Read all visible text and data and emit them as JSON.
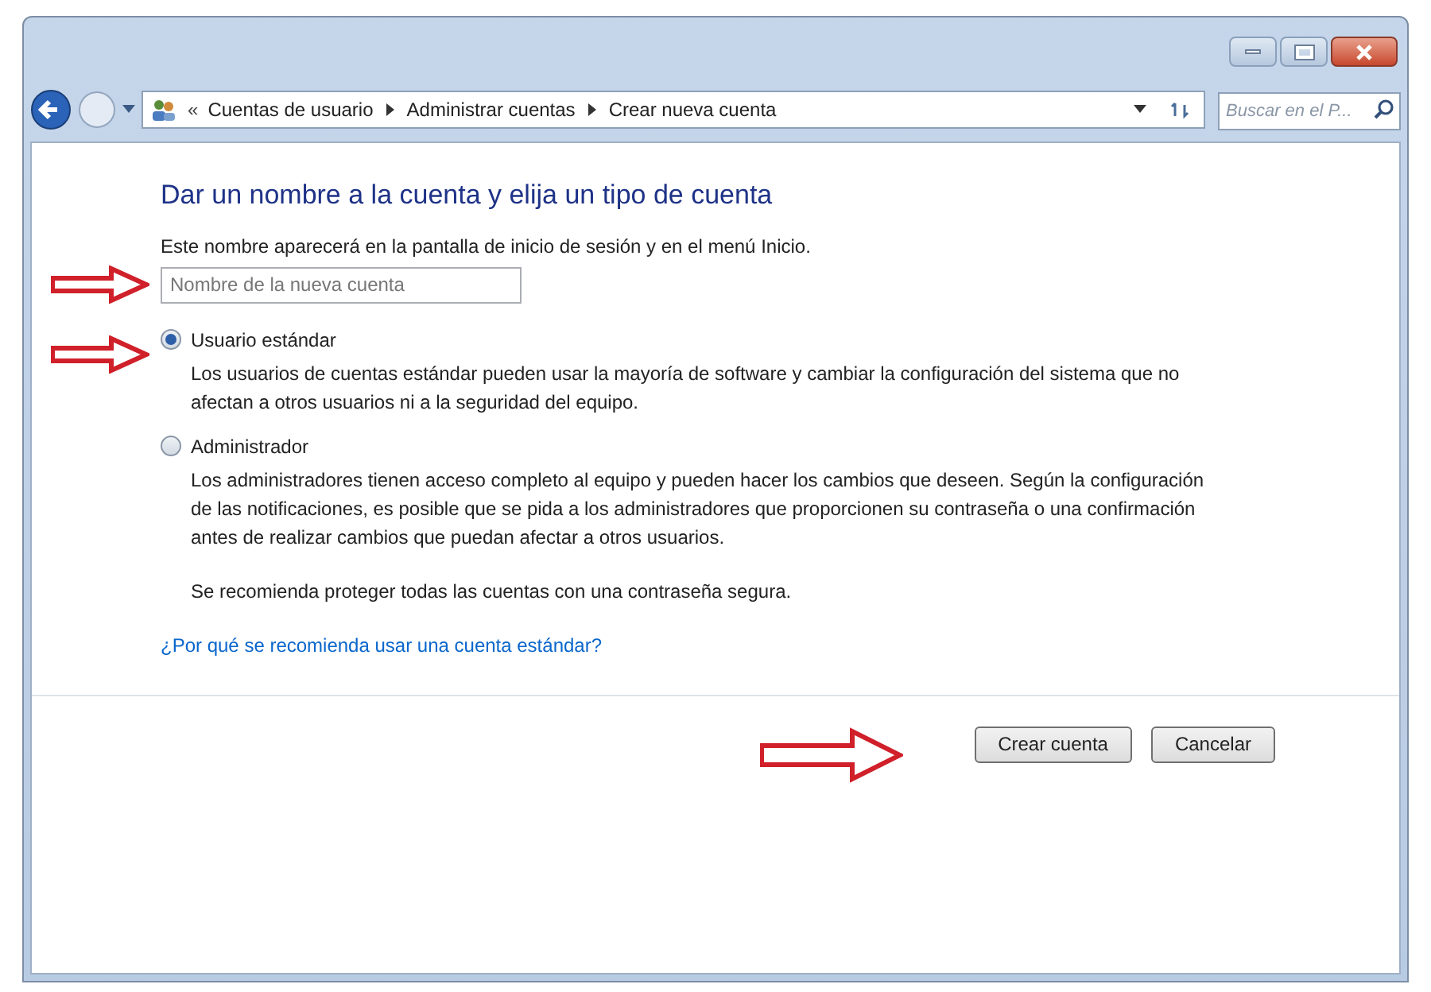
{
  "address_bar": {
    "breadcrumbs": [
      "Cuentas de usuario",
      "Administrar cuentas",
      "Crear nueva cuenta"
    ],
    "overflow": "«"
  },
  "search": {
    "placeholder": "Buscar en el P..."
  },
  "heading": "Dar un nombre a la cuenta y elija un tipo de cuenta",
  "intro": "Este nombre aparecerá en la pantalla de inicio de sesión y en el menú Inicio.",
  "name_field": {
    "placeholder": "Nombre de la nueva cuenta"
  },
  "account_types": [
    {
      "label": "Usuario estándar",
      "selected": true,
      "description": "Los usuarios de cuentas estándar pueden usar la mayoría de software y cambiar la configuración del sistema que no afectan a otros usuarios ni a la seguridad del equipo."
    },
    {
      "label": "Administrador",
      "selected": false,
      "description": "Los administradores tienen acceso completo al equipo y pueden hacer los cambios que deseen. Según la configuración de las notificaciones, es posible que se pida a los administradores que proporcionen su contraseña o una confirmación antes de realizar cambios que puedan afectar a otros usuarios."
    }
  ],
  "recommendation": "Se recomienda proteger todas las cuentas con una contraseña segura.",
  "help_link": "¿Por qué se recomienda usar una cuenta estándar?",
  "buttons": [
    "Crear cuenta",
    "Cancelar"
  ]
}
